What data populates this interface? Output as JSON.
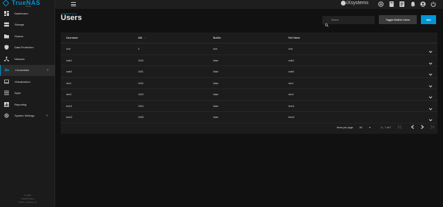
{
  "app": {
    "logo_text": "TrueNAS",
    "logo_sub": "SCALE",
    "brand": "iXsystems"
  },
  "sidebar": {
    "items": [
      {
        "label": "Dashboard",
        "icon": "dashboard-icon"
      },
      {
        "label": "Storage",
        "icon": "storage-icon"
      },
      {
        "label": "Shares",
        "icon": "shares-icon"
      },
      {
        "label": "Data Protection",
        "icon": "shield-icon"
      },
      {
        "label": "Network",
        "icon": "network-icon"
      },
      {
        "label": "Credentials",
        "icon": "key-icon",
        "active": true,
        "chevron": true
      },
      {
        "label": "Virtualization",
        "icon": "monitor-icon"
      },
      {
        "label": "Apps",
        "icon": "apps-icon"
      },
      {
        "label": "Reporting",
        "icon": "reporting-icon"
      },
      {
        "label": "System Settings",
        "icon": "gear-icon",
        "chevron": true
      }
    ],
    "footer_line1": "TrueNAS",
    "footer_line2": "TrueNAS SCALE",
    "footer_line3": "© 2024 - iXsystems, Inc."
  },
  "header": {
    "breadcrumb": "CREDENTIALS",
    "title": "Users"
  },
  "toolbar": {
    "search_placeholder": "Search",
    "toggle_label": "Toggle Built-In Users",
    "add_label": "Add"
  },
  "table": {
    "columns": [
      "Username",
      "UID",
      "Builtin",
      "Full Name"
    ],
    "uid_sort_indicator": "↑",
    "rows": [
      {
        "username": "root",
        "uid": "0",
        "builtin": "true",
        "full_name": "root"
      },
      {
        "username": "sale1",
        "uid": "1000",
        "builtin": "false",
        "full_name": "sale1"
      },
      {
        "username": "sale2",
        "uid": "1001",
        "builtin": "false",
        "full_name": "sale2"
      },
      {
        "username": "dev1",
        "uid": "1002",
        "builtin": "false",
        "full_name": "dev1"
      },
      {
        "username": "dev2",
        "uid": "1003",
        "builtin": "false",
        "full_name": "dev2"
      },
      {
        "username": "tech1",
        "uid": "1004",
        "builtin": "false",
        "full_name": "tech1"
      },
      {
        "username": "tech2",
        "uid": "1005",
        "builtin": "false",
        "full_name": "tech2"
      }
    ]
  },
  "pager": {
    "items_per_page_label": "Items per page:",
    "items_per_page_value": "50",
    "range": "1 – 7 of 7"
  },
  "colors": {
    "accent": "#0095d5",
    "background": "#111111",
    "card": "#1c1c1c"
  }
}
